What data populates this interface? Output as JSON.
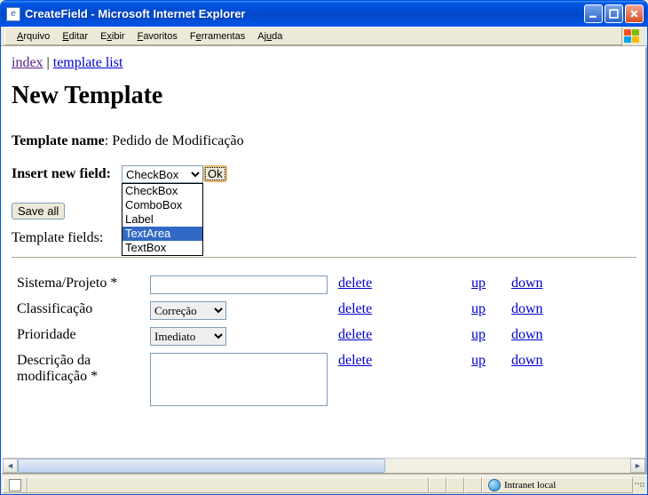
{
  "window": {
    "title": "CreateField - Microsoft Internet Explorer"
  },
  "menus": {
    "arquivo": "Arquivo",
    "editar": "Editar",
    "exibir": "Exibir",
    "favoritos": "Favoritos",
    "ferramentas": "Ferramentas",
    "ajuda": "Ajuda"
  },
  "breadcrumb": {
    "index": "index",
    "template_list": "template list",
    "sep": " | "
  },
  "page": {
    "heading": "New Template",
    "template_name_label": "Template name",
    "template_name_value": "Pedido de Modificação",
    "insert_label": "Insert new field:",
    "ok_label": "Ok",
    "save_all_label": "Save all",
    "template_fields_label": "Template fields:"
  },
  "field_type_select": {
    "selected": "CheckBox",
    "options": [
      "CheckBox",
      "ComboBox",
      "Label",
      "TextArea",
      "TextBox"
    ],
    "highlighted": "TextArea"
  },
  "links": {
    "delete": "delete",
    "up": "up",
    "down": "down"
  },
  "fields": [
    {
      "label": "Sistema/Projeto *",
      "type": "text",
      "value": ""
    },
    {
      "label": "Classificação",
      "type": "select",
      "value": "Correção"
    },
    {
      "label": "Prioridade",
      "type": "select",
      "value": "Imediato"
    },
    {
      "label": "Descrição da modificação *",
      "type": "textarea",
      "value": ""
    }
  ],
  "statusbar": {
    "zone": "Intranet local"
  }
}
